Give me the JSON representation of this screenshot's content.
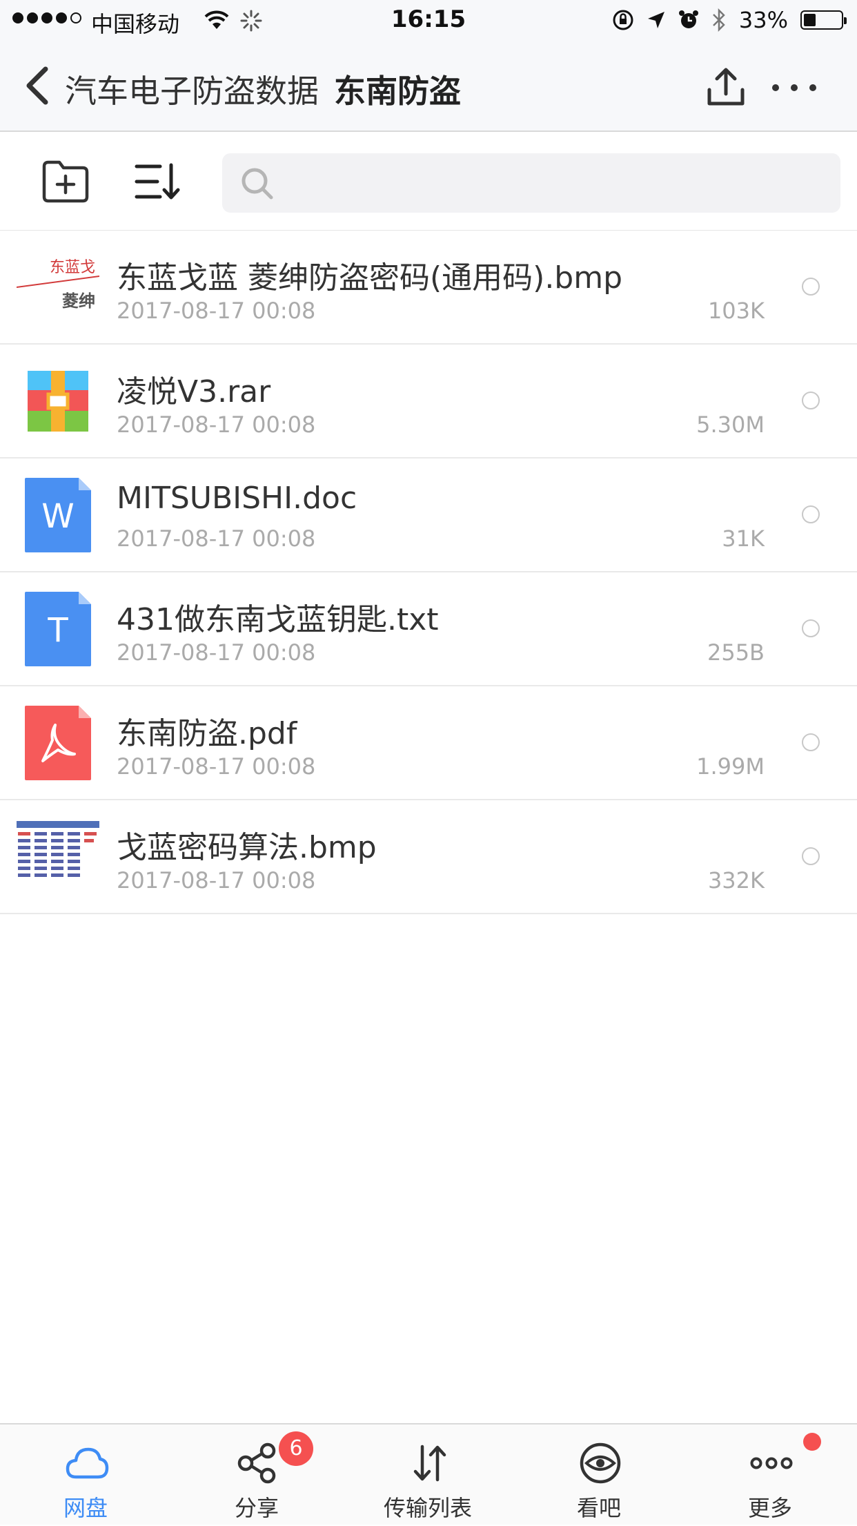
{
  "status_bar": {
    "carrier": "中国移动",
    "time": "16:15",
    "battery_text": "33%",
    "battery_level": 0.33
  },
  "nav": {
    "parent_folder": "汽车电子防盗数据",
    "current_folder": "东南防盗"
  },
  "search": {
    "placeholder": ""
  },
  "files": [
    {
      "name": "东蓝戈蓝 菱绅防盗密码(通用码).bmp",
      "date": "2017-08-17 00:08",
      "size": "103K",
      "thumb_text_1": "东蓝戈",
      "thumb_text_2": "菱绅"
    },
    {
      "name": "凌悦V3.rar",
      "date": "2017-08-17 00:08",
      "size": "5.30M"
    },
    {
      "name": "MITSUBISHI.doc",
      "date": "2017-08-17 00:08",
      "size": "31K",
      "icon_letter": "W"
    },
    {
      "name": "431做东南戈蓝钥匙.txt",
      "date": "2017-08-17 00:08",
      "size": "255B",
      "icon_letter": "T"
    },
    {
      "name": "东南防盗.pdf",
      "date": "2017-08-17 00:08",
      "size": "1.99M"
    },
    {
      "name": "戈蓝密码算法.bmp",
      "date": "2017-08-17 00:08",
      "size": "332K"
    }
  ],
  "tabs": [
    {
      "label": "网盘",
      "icon": "cloud-icon"
    },
    {
      "label": "分享",
      "icon": "share-icon",
      "badge": "6"
    },
    {
      "label": "传输列表",
      "icon": "transfer-icon"
    },
    {
      "label": "看吧",
      "icon": "eye-icon"
    },
    {
      "label": "更多",
      "icon": "more-dots-icon"
    }
  ],
  "colors": {
    "accent": "#3e8cf5",
    "badge": "#f55050",
    "doc_blue": "#4a90f2",
    "pdf_red": "#f65a5a"
  }
}
